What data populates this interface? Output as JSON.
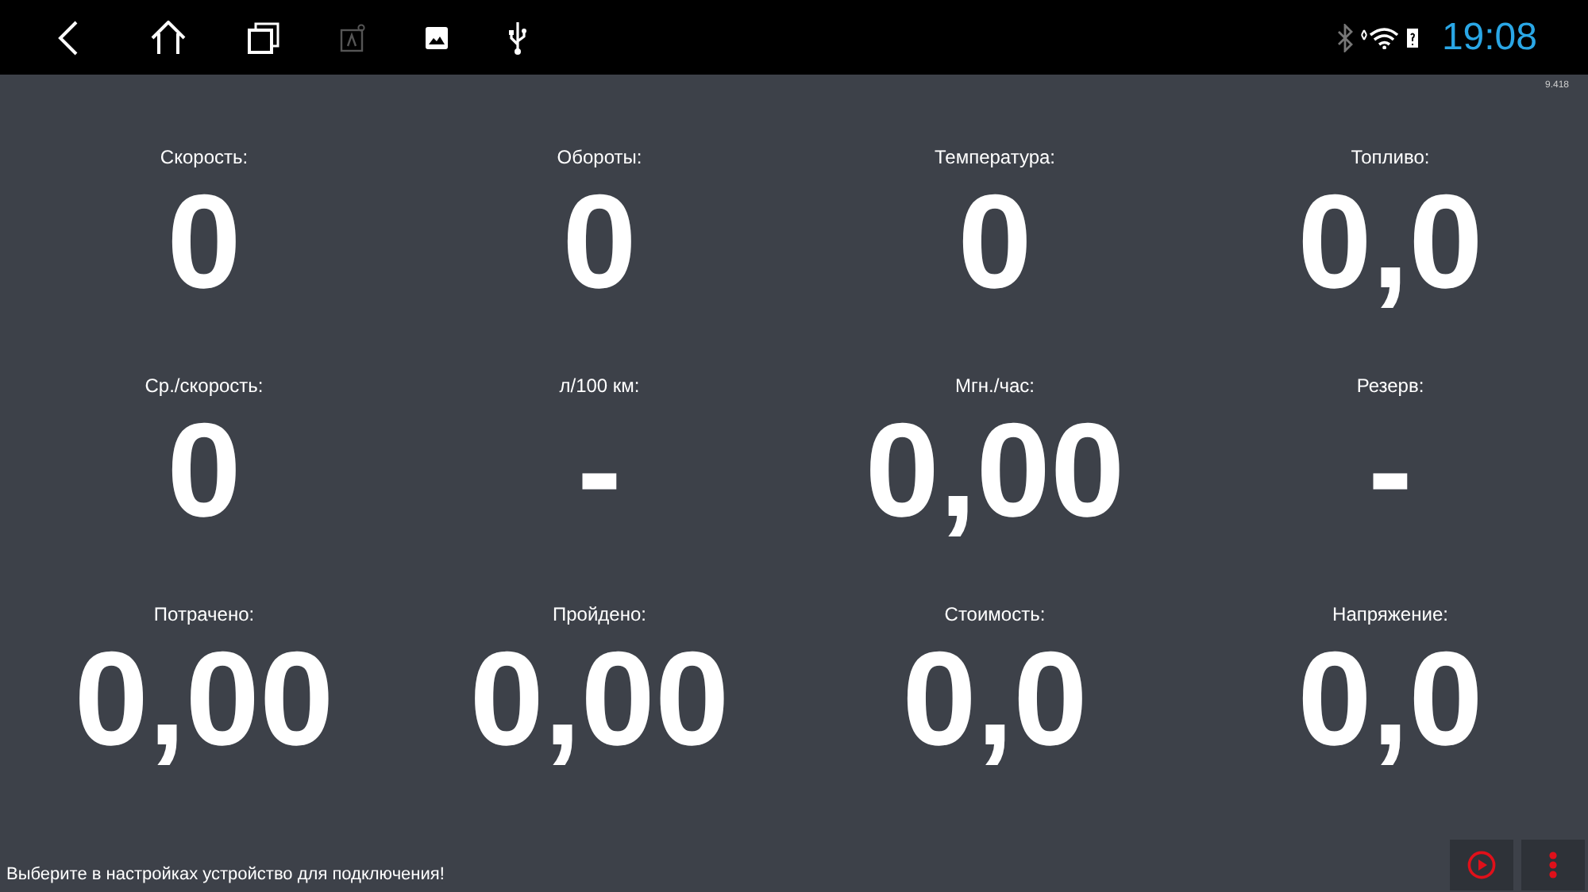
{
  "status_bar": {
    "time": "19:08"
  },
  "version": "9.418",
  "metrics": [
    {
      "label": "Скорость:",
      "value": "0"
    },
    {
      "label": "Обороты:",
      "value": "0"
    },
    {
      "label": "Температура:",
      "value": "0"
    },
    {
      "label": "Топливо:",
      "value": "0,0"
    },
    {
      "label": "Ср./скорость:",
      "value": "0"
    },
    {
      "label": "л/100 км:",
      "value": "-"
    },
    {
      "label": "Мгн./час:",
      "value": "0,00"
    },
    {
      "label": "Резерв:",
      "value": "-"
    },
    {
      "label": "Потрачено:",
      "value": "0,00"
    },
    {
      "label": "Пройдено:",
      "value": "0,00"
    },
    {
      "label": "Стоимость:",
      "value": "0,0"
    },
    {
      "label": "Напряжение:",
      "value": "0,0"
    }
  ],
  "message": "Выберите в настройках устройство для подключения!"
}
